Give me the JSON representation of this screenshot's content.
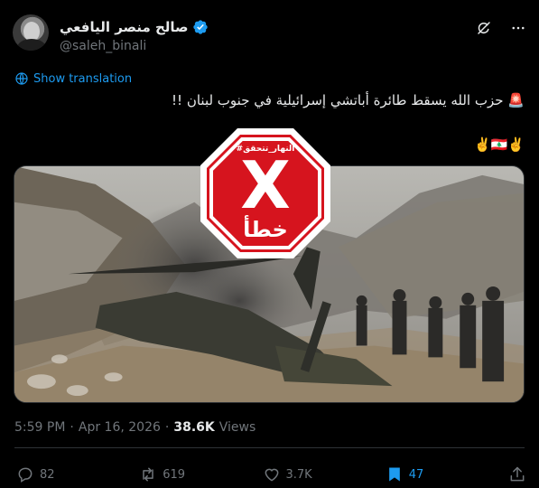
{
  "author": {
    "display_name": "صالح منصر اليافعي",
    "handle": "@saleh_binali"
  },
  "translate_label": "Show translation",
  "tweet": {
    "line1_emoji": "🚨",
    "line1": "حزب الله يسقط طائرة أباتشي إسرائيلية في جنوب لبنان !!",
    "line2": "✌️🇱🇧✌️"
  },
  "overlay": {
    "tag": "#النهار_تتحقق",
    "verdict": "خطأ",
    "mark": "X",
    "color": "#d6141e"
  },
  "meta": {
    "time": "5:59 PM",
    "sep": "·",
    "date": "Apr 16, 2026",
    "views_count": "38.6K",
    "views_label": "Views"
  },
  "actions": {
    "replies": "82",
    "reposts": "619",
    "likes": "3.7K",
    "bookmarks": "47"
  },
  "colors": {
    "accent": "#1d9bf0",
    "muted": "#71767b",
    "text": "#e7e9ea"
  },
  "icons": [
    "verified-badge-icon",
    "grok-icon",
    "more-icon",
    "translate-icon",
    "reply-icon",
    "repost-icon",
    "like-icon",
    "bookmark-icon",
    "share-icon"
  ]
}
